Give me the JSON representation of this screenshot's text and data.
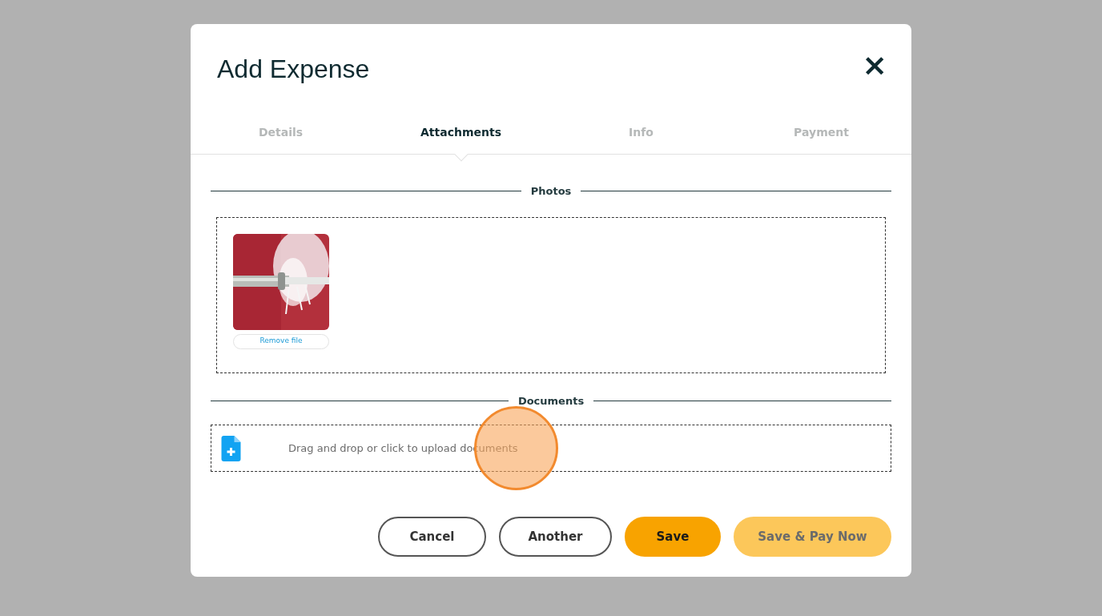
{
  "dialog": {
    "title": "Add Expense",
    "close": "×"
  },
  "tabs": [
    {
      "label": "Details",
      "selected": false
    },
    {
      "label": "Attachments",
      "selected": true
    },
    {
      "label": "Info",
      "selected": false
    },
    {
      "label": "Payment",
      "selected": false
    }
  ],
  "photos": {
    "heading": "Photos",
    "files": [
      {
        "kind": "picture",
        "remove": "Remove file"
      }
    ]
  },
  "documents": {
    "heading": "Documents",
    "upload_text": "Drag and drop or click to upload documents"
  },
  "buttons": [
    {
      "label": "Cancel",
      "kind": "outline"
    },
    {
      "label": "Another",
      "kind": "outline"
    },
    {
      "label": "Save",
      "kind": "primary"
    },
    {
      "label": "Save & Pay Now",
      "kind": "muted"
    }
  ]
}
